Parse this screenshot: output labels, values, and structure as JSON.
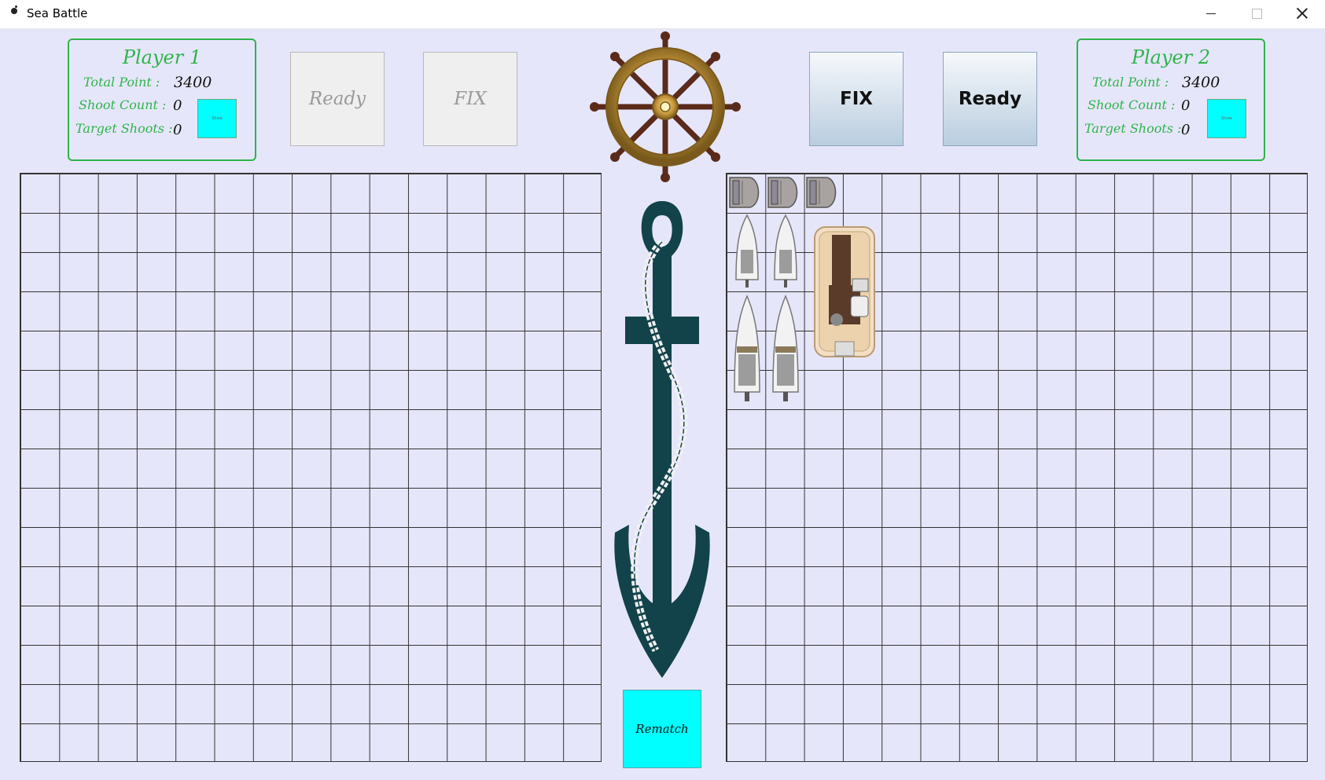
{
  "window": {
    "title": "Sea Battle"
  },
  "player1": {
    "name": "Player 1",
    "total_label": "Total Point :",
    "total_value": "3400",
    "shoot_label": "Shoot Count :",
    "shoot_value": "0",
    "target_label": "Target Shoots :",
    "target_value": "0",
    "box_text": "Show"
  },
  "player2": {
    "name": "Player 2",
    "total_label": "Total Point :",
    "total_value": "3400",
    "shoot_label": "Shoot Count :",
    "shoot_value": "0",
    "target_label": "Target Shoots :",
    "target_value": "0",
    "box_text": "Show"
  },
  "buttons": {
    "p1_ready": "Ready",
    "p1_fix": "FIX",
    "p2_fix": "FIX",
    "p2_ready": "Ready",
    "rematch": "Rematch"
  },
  "board": {
    "rows": 15,
    "cols": 15
  },
  "colors": {
    "background": "#e6e6fa",
    "accent_green": "#2fb44a",
    "cyan": "#00ffff"
  },
  "icons": [
    "ship-wheel-icon",
    "anchor-icon",
    "dinghy-icon",
    "speedboat-icon",
    "pontoon-boat-icon"
  ]
}
